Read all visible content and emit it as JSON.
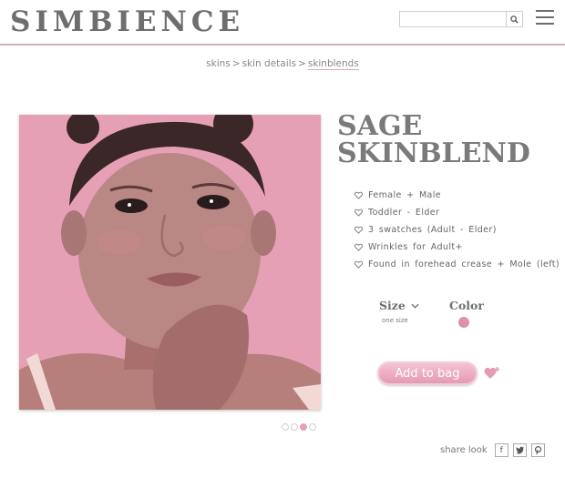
{
  "header": {
    "logo": "SIMBIENCE",
    "search": {
      "placeholder": "",
      "value": ""
    },
    "icons": [
      "search-icon",
      "hamburger-menu-icon"
    ]
  },
  "breadcrumb": {
    "items": [
      "skins",
      "skin details",
      "skinblends"
    ],
    "separator": ">"
  },
  "product": {
    "title_line1": "SAGE",
    "title_line2": "SKINBLEND",
    "features": [
      "Female + Male",
      "Toddler - Elder",
      "3 swatches (Adult - Elder)",
      "Wrinkles for Adult+",
      "Found in forehead crease + Mole (left)"
    ],
    "feature_icon": "heart-outline-icon",
    "size_label": "Size",
    "size_value": "one size",
    "color_label": "Color",
    "selected_color": "#e08fad",
    "add_to_bag": "Add to bag",
    "image_background": "#e6a0b6"
  },
  "carousel": {
    "count": 4,
    "active_index": 2
  },
  "share": {
    "label": "share look",
    "networks": [
      "f",
      "twitter-icon",
      "pinterest-icon"
    ]
  },
  "colors": {
    "accent": "#e6a0b6",
    "header_line": "#d8a9b8",
    "text": "#6e6e6e"
  }
}
